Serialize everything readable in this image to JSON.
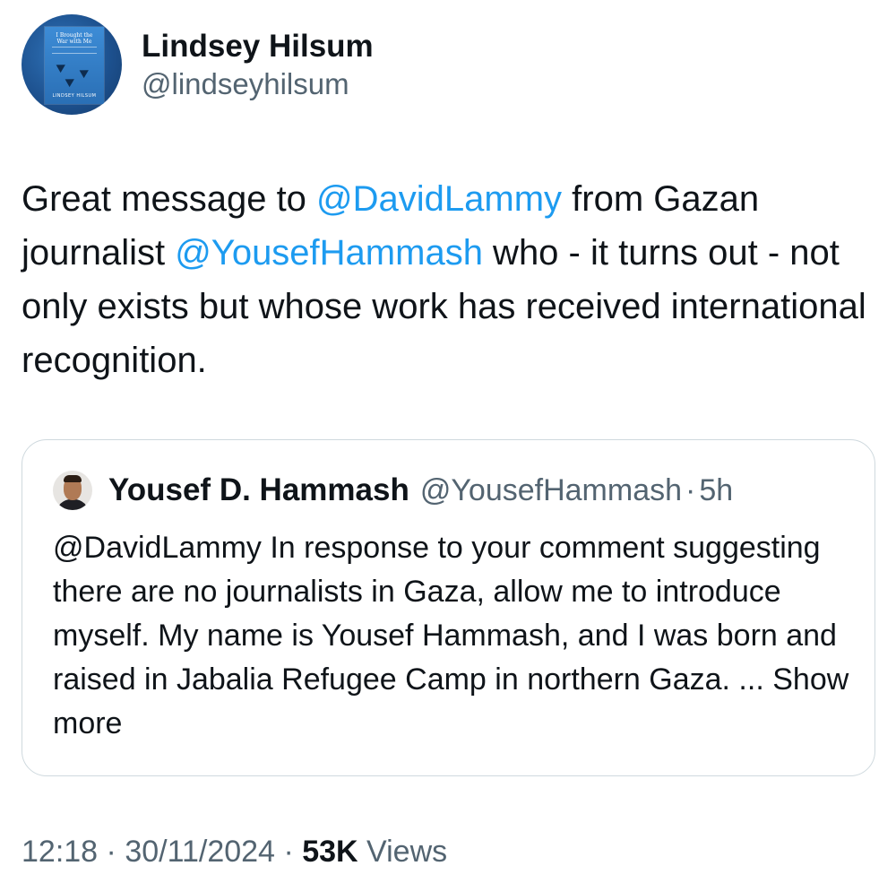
{
  "author": {
    "display_name": "Lindsey Hilsum",
    "handle": "@lindseyhilsum",
    "avatar": {
      "book_title": "I Brought the War with Me",
      "book_author": "LINDSEY HILSUM"
    }
  },
  "tweet": {
    "text_parts": [
      {
        "type": "text",
        "value": "Great message to "
      },
      {
        "type": "mention",
        "value": "@DavidLammy"
      },
      {
        "type": "text",
        "value": " from Gazan journalist "
      },
      {
        "type": "mention",
        "value": "@YousefHammash"
      },
      {
        "type": "text",
        "value": " who - it turns out - not only exists but whose work has received international recognition."
      }
    ]
  },
  "quote": {
    "display_name": "Yousef D. Hammash",
    "handle": "@YousefHammash",
    "separator": "·",
    "time": "5h",
    "text": "@DavidLammy In response to your comment suggesting there are no journalists in Gaza, allow me to introduce myself. My name is Yousef Hammash, and I was born and raised in Jabalia Refugee Camp in northern Gaza. ...",
    "show_more_label": "Show more"
  },
  "meta": {
    "time": "12:18",
    "separator": "·",
    "date": "30/11/2024",
    "views_count": "53K",
    "views_label": "Views"
  },
  "colors": {
    "text": "#0f1419",
    "secondary": "#536471",
    "mention": "#1d9bf0",
    "border": "#cfd9de"
  }
}
